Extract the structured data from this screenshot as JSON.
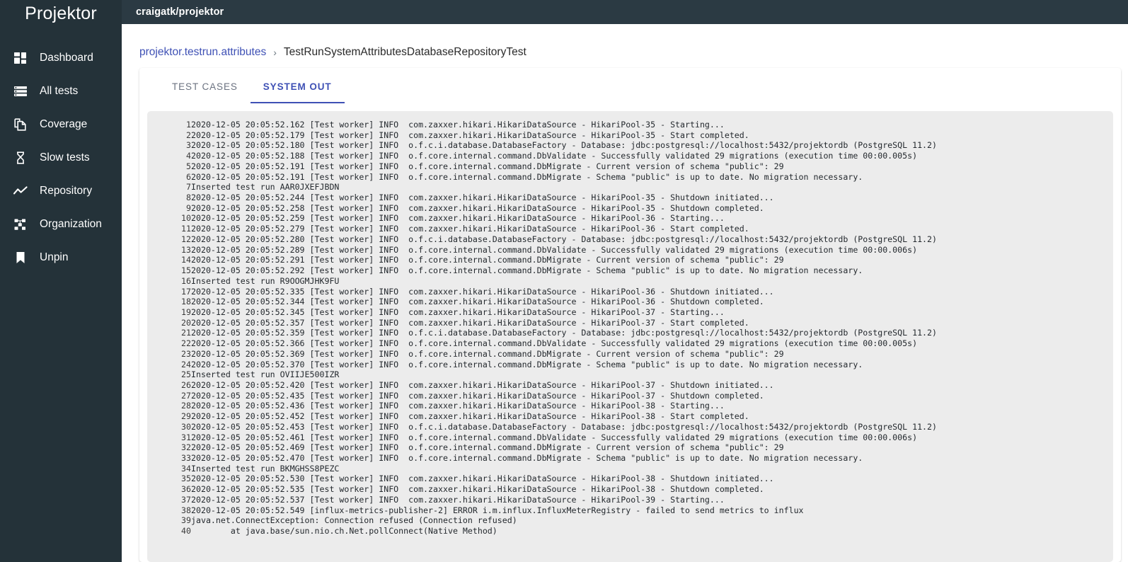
{
  "sidebar": {
    "brand": "Projektor",
    "items": [
      {
        "label": "Dashboard",
        "icon": "dashboard-grid-icon"
      },
      {
        "label": "All tests",
        "icon": "list-icon"
      },
      {
        "label": "Coverage",
        "icon": "copy-pages-icon"
      },
      {
        "label": "Slow tests",
        "icon": "hourglass-icon"
      },
      {
        "label": "Repository",
        "icon": "trend-line-icon"
      },
      {
        "label": "Organization",
        "icon": "org-chart-icon"
      },
      {
        "label": "Unpin",
        "icon": "bookmark-icon"
      }
    ]
  },
  "topbar": {
    "title": "craigatk/projektor"
  },
  "breadcrumb": {
    "parent": "projektor.testrun.attributes",
    "separator": "›",
    "current": "TestRunSystemAttributesDatabaseRepositoryTest"
  },
  "tabs": [
    {
      "label": "TEST CASES",
      "active": false
    },
    {
      "label": "SYSTEM OUT",
      "active": true
    }
  ],
  "colors": {
    "sidebar_bg": "#243239",
    "topbar_bg": "#2b3a43",
    "accent": "#3f51b5",
    "log_bg": "#ececec",
    "log_text": "#24292e"
  },
  "system_out": {
    "lines": [
      {
        "n": 1,
        "text": "2020-12-05 20:05:52.162 [Test worker] INFO  com.zaxxer.hikari.HikariDataSource - HikariPool-35 - Starting..."
      },
      {
        "n": 2,
        "text": "2020-12-05 20:05:52.179 [Test worker] INFO  com.zaxxer.hikari.HikariDataSource - HikariPool-35 - Start completed."
      },
      {
        "n": 3,
        "text": "2020-12-05 20:05:52.180 [Test worker] INFO  o.f.c.i.database.DatabaseFactory - Database: jdbc:postgresql://localhost:5432/projektordb (PostgreSQL 11.2)"
      },
      {
        "n": 4,
        "text": "2020-12-05 20:05:52.188 [Test worker] INFO  o.f.core.internal.command.DbValidate - Successfully validated 29 migrations (execution time 00:00.005s)"
      },
      {
        "n": 5,
        "text": "2020-12-05 20:05:52.191 [Test worker] INFO  o.f.core.internal.command.DbMigrate - Current version of schema \"public\": 29"
      },
      {
        "n": 6,
        "text": "2020-12-05 20:05:52.191 [Test worker] INFO  o.f.core.internal.command.DbMigrate - Schema \"public\" is up to date. No migration necessary."
      },
      {
        "n": 7,
        "text": "Inserted test run AAR0JXEFJBDN"
      },
      {
        "n": 8,
        "text": "2020-12-05 20:05:52.244 [Test worker] INFO  com.zaxxer.hikari.HikariDataSource - HikariPool-35 - Shutdown initiated..."
      },
      {
        "n": 9,
        "text": "2020-12-05 20:05:52.258 [Test worker] INFO  com.zaxxer.hikari.HikariDataSource - HikariPool-35 - Shutdown completed."
      },
      {
        "n": 10,
        "text": "2020-12-05 20:05:52.259 [Test worker] INFO  com.zaxxer.hikari.HikariDataSource - HikariPool-36 - Starting..."
      },
      {
        "n": 11,
        "text": "2020-12-05 20:05:52.279 [Test worker] INFO  com.zaxxer.hikari.HikariDataSource - HikariPool-36 - Start completed."
      },
      {
        "n": 12,
        "text": "2020-12-05 20:05:52.280 [Test worker] INFO  o.f.c.i.database.DatabaseFactory - Database: jdbc:postgresql://localhost:5432/projektordb (PostgreSQL 11.2)"
      },
      {
        "n": 13,
        "text": "2020-12-05 20:05:52.289 [Test worker] INFO  o.f.core.internal.command.DbValidate - Successfully validated 29 migrations (execution time 00:00.006s)"
      },
      {
        "n": 14,
        "text": "2020-12-05 20:05:52.291 [Test worker] INFO  o.f.core.internal.command.DbMigrate - Current version of schema \"public\": 29"
      },
      {
        "n": 15,
        "text": "2020-12-05 20:05:52.292 [Test worker] INFO  o.f.core.internal.command.DbMigrate - Schema \"public\" is up to date. No migration necessary."
      },
      {
        "n": 16,
        "text": "Inserted test run R9OOGMJHK9FU"
      },
      {
        "n": 17,
        "text": "2020-12-05 20:05:52.335 [Test worker] INFO  com.zaxxer.hikari.HikariDataSource - HikariPool-36 - Shutdown initiated..."
      },
      {
        "n": 18,
        "text": "2020-12-05 20:05:52.344 [Test worker] INFO  com.zaxxer.hikari.HikariDataSource - HikariPool-36 - Shutdown completed."
      },
      {
        "n": 19,
        "text": "2020-12-05 20:05:52.345 [Test worker] INFO  com.zaxxer.hikari.HikariDataSource - HikariPool-37 - Starting..."
      },
      {
        "n": 20,
        "text": "2020-12-05 20:05:52.357 [Test worker] INFO  com.zaxxer.hikari.HikariDataSource - HikariPool-37 - Start completed."
      },
      {
        "n": 21,
        "text": "2020-12-05 20:05:52.359 [Test worker] INFO  o.f.c.i.database.DatabaseFactory - Database: jdbc:postgresql://localhost:5432/projektordb (PostgreSQL 11.2)"
      },
      {
        "n": 22,
        "text": "2020-12-05 20:05:52.366 [Test worker] INFO  o.f.core.internal.command.DbValidate - Successfully validated 29 migrations (execution time 00:00.005s)"
      },
      {
        "n": 23,
        "text": "2020-12-05 20:05:52.369 [Test worker] INFO  o.f.core.internal.command.DbMigrate - Current version of schema \"public\": 29"
      },
      {
        "n": 24,
        "text": "2020-12-05 20:05:52.370 [Test worker] INFO  o.f.core.internal.command.DbMigrate - Schema \"public\" is up to date. No migration necessary."
      },
      {
        "n": 25,
        "text": "Inserted test run OVIIJE500IZR"
      },
      {
        "n": 26,
        "text": "2020-12-05 20:05:52.420 [Test worker] INFO  com.zaxxer.hikari.HikariDataSource - HikariPool-37 - Shutdown initiated..."
      },
      {
        "n": 27,
        "text": "2020-12-05 20:05:52.435 [Test worker] INFO  com.zaxxer.hikari.HikariDataSource - HikariPool-37 - Shutdown completed."
      },
      {
        "n": 28,
        "text": "2020-12-05 20:05:52.436 [Test worker] INFO  com.zaxxer.hikari.HikariDataSource - HikariPool-38 - Starting..."
      },
      {
        "n": 29,
        "text": "2020-12-05 20:05:52.452 [Test worker] INFO  com.zaxxer.hikari.HikariDataSource - HikariPool-38 - Start completed."
      },
      {
        "n": 30,
        "text": "2020-12-05 20:05:52.453 [Test worker] INFO  o.f.c.i.database.DatabaseFactory - Database: jdbc:postgresql://localhost:5432/projektordb (PostgreSQL 11.2)"
      },
      {
        "n": 31,
        "text": "2020-12-05 20:05:52.461 [Test worker] INFO  o.f.core.internal.command.DbValidate - Successfully validated 29 migrations (execution time 00:00.006s)"
      },
      {
        "n": 32,
        "text": "2020-12-05 20:05:52.469 [Test worker] INFO  o.f.core.internal.command.DbMigrate - Current version of schema \"public\": 29"
      },
      {
        "n": 33,
        "text": "2020-12-05 20:05:52.470 [Test worker] INFO  o.f.core.internal.command.DbMigrate - Schema \"public\" is up to date. No migration necessary."
      },
      {
        "n": 34,
        "text": "Inserted test run BKMGHSS8PEZC"
      },
      {
        "n": 35,
        "text": "2020-12-05 20:05:52.530 [Test worker] INFO  com.zaxxer.hikari.HikariDataSource - HikariPool-38 - Shutdown initiated..."
      },
      {
        "n": 36,
        "text": "2020-12-05 20:05:52.535 [Test worker] INFO  com.zaxxer.hikari.HikariDataSource - HikariPool-38 - Shutdown completed."
      },
      {
        "n": 37,
        "text": "2020-12-05 20:05:52.537 [Test worker] INFO  com.zaxxer.hikari.HikariDataSource - HikariPool-39 - Starting..."
      },
      {
        "n": 38,
        "text": "2020-12-05 20:05:52.549 [influx-metrics-publisher-2] ERROR i.m.influx.InfluxMeterRegistry - failed to send metrics to influx"
      },
      {
        "n": 39,
        "text": "java.net.ConnectException: Connection refused (Connection refused)"
      },
      {
        "n": 40,
        "text": "        at java.base/sun.nio.ch.Net.pollConnect(Native Method)"
      }
    ]
  }
}
